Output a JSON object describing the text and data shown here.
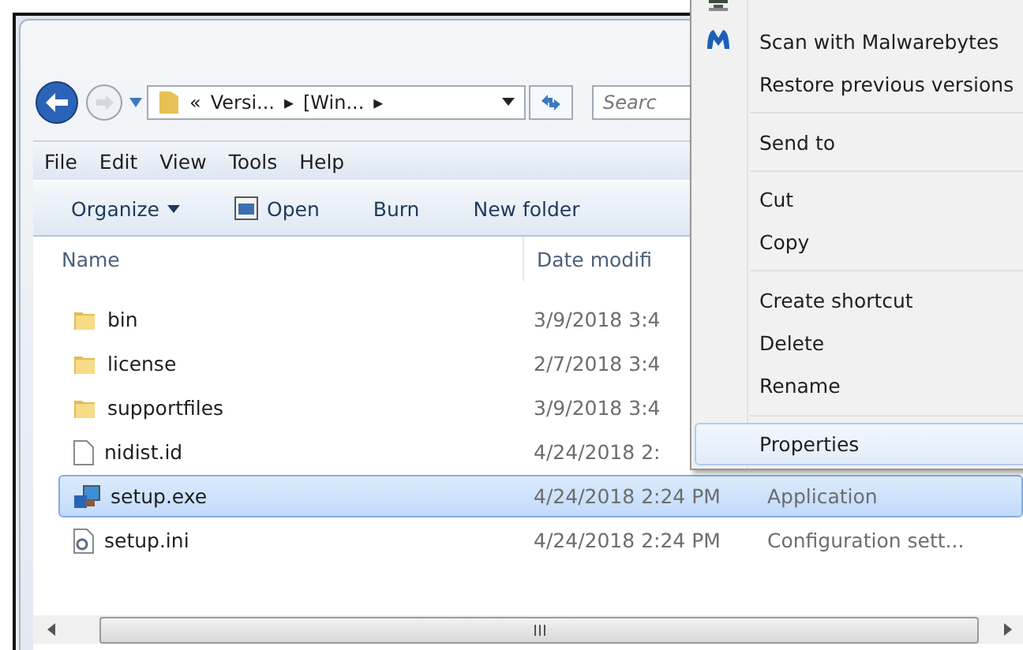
{
  "address": {
    "crumbs": [
      "«",
      "Versi...",
      "▸",
      "[Win...",
      "▸"
    ]
  },
  "search": {
    "placeholder": "Searc"
  },
  "menu_bar": [
    "File",
    "Edit",
    "View",
    "Tools",
    "Help"
  ],
  "toolbar": [
    {
      "label": "Organize",
      "kind": "dropdown"
    },
    {
      "label": "Open",
      "kind": "icon"
    },
    {
      "label": "Burn",
      "kind": "plain"
    },
    {
      "label": "New folder",
      "kind": "plain"
    }
  ],
  "columns": [
    "Name",
    "Date modifi"
  ],
  "rows": [
    {
      "name": "bin",
      "kind": "folder",
      "date": "3/9/2018 3:4",
      "selected": false
    },
    {
      "name": "license",
      "kind": "folder",
      "date": "2/7/2018 3:4",
      "selected": false
    },
    {
      "name": "supportfiles",
      "kind": "folder",
      "date": "3/9/2018 3:4",
      "selected": false
    },
    {
      "name": "nidist.id",
      "kind": "file",
      "date": "4/24/2018 2:",
      "selected": false
    },
    {
      "name": "setup.exe",
      "kind": "exe",
      "date": "4/24/2018 2:24 PM",
      "type": "Application",
      "selected": true
    },
    {
      "name": "setup.ini",
      "kind": "ini",
      "date": "4/24/2018 2:24 PM",
      "type": "Configuration sett...",
      "selected": false
    }
  ],
  "context_menu": [
    {
      "kind": "item",
      "label": "Scan with Malwarebytes",
      "selected": false
    },
    {
      "kind": "item",
      "label": "Restore previous versions",
      "selected": false
    },
    {
      "kind": "separator"
    },
    {
      "kind": "item",
      "label": "Send to",
      "selected": false
    },
    {
      "kind": "separator"
    },
    {
      "kind": "item",
      "label": "Cut",
      "selected": false
    },
    {
      "kind": "item",
      "label": "Copy",
      "selected": false
    },
    {
      "kind": "separator"
    },
    {
      "kind": "item",
      "label": "Create shortcut",
      "selected": false
    },
    {
      "kind": "item",
      "label": "Delete",
      "selected": false
    },
    {
      "kind": "item",
      "label": "Rename",
      "selected": false
    },
    {
      "kind": "separator"
    },
    {
      "kind": "item",
      "label": "Properties",
      "selected": true
    }
  ]
}
